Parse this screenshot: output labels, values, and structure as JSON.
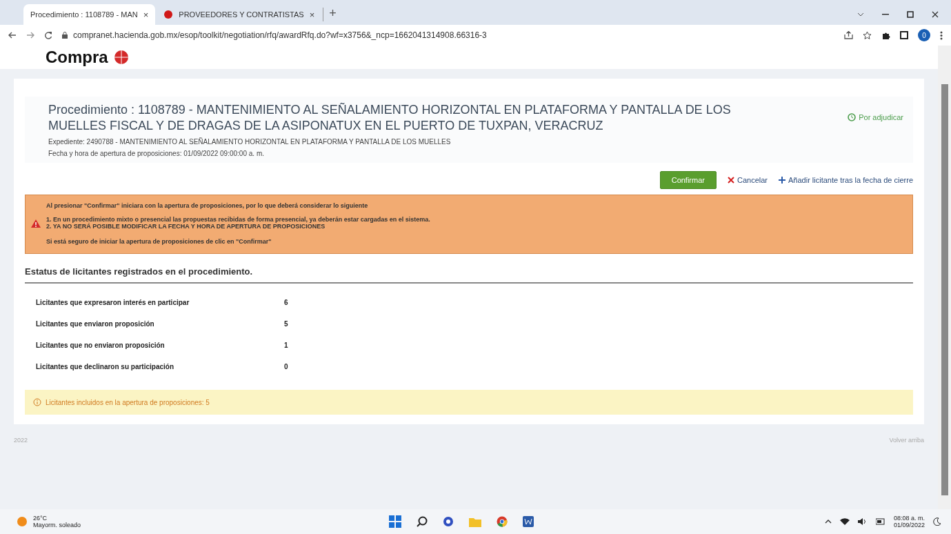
{
  "browser": {
    "tabs": [
      {
        "title": "Procedimiento : 1108789 - MAN",
        "close": "×",
        "selected": true,
        "kind": "page"
      },
      {
        "title": "PROVEEDORES Y CONTRATISTAS",
        "close": "×",
        "selected": false,
        "kind": "site"
      }
    ],
    "new_tab": "+",
    "url": "compranet.hacienda.gob.mx/esop/toolkit/negotiation/rfq/awardRfq.do?wf=x3756&_ncp=1662041314908.66316-3",
    "profile": "0"
  },
  "logo": {
    "text": "Compra"
  },
  "procedure": {
    "title": "Procedimiento : 1108789 - MANTENIMIENTO AL SEÑALAMIENTO HORIZONTAL EN PLATAFORMA Y PANTALLA DE LOS MUELLES FISCAL Y DE DRAGAS DE LA ASIPONATUX EN EL PUERTO DE TUXPAN, VERACRUZ",
    "file": "Expediente: 2490788 - MANTENIMIENTO AL SEÑALAMIENTO HORIZONTAL EN PLATAFORMA Y PANTALLA DE LOS MUELLES",
    "opening": "Fecha y hora de apertura de proposiciones: 01/09/2022 09:00:00 a. m.",
    "status": "Por adjudicar"
  },
  "actions": [
    {
      "kind": "primary",
      "label": "Confirmar"
    },
    {
      "kind": "cancel",
      "label": "Cancelar"
    },
    {
      "kind": "add",
      "label": "Añadir licitante tras la fecha de cierre"
    }
  ],
  "warning": {
    "intro": "Al presionar \"Confirmar\" iniciara con la apertura de proposiciones, por lo que deberá considerar lo siguiente",
    "points": [
      "1. En un procedimiento mixto o presencial las propuestas recibidas de forma presencial, ya deberán estar cargadas en el sistema.",
      "2. YA NO SERÁ POSIBLE MODIFICAR LA FECHA Y HORA DE APERTURA DE PROPOSICIONES"
    ],
    "outro": "Si está seguro de iniciar la apertura de proposiciones de clic en \"Confirmar\""
  },
  "stats": {
    "heading": "Estatus de licitantes registrados en el procedimiento.",
    "rows": [
      {
        "label": "Licitantes que expresaron interés en participar",
        "value": "6"
      },
      {
        "label": "Licitantes que enviaron proposición",
        "value": "5"
      },
      {
        "label": "Licitantes que no enviaron proposición",
        "value": "1"
      },
      {
        "label": "Licitantes que declinaron su participación",
        "value": "0"
      }
    ]
  },
  "info": "Licitantes incluidos en la apertura de proposiciones: 5",
  "footer": {
    "year": "2022",
    "back_to_top": "Volver arriba"
  },
  "taskbar": {
    "temperature": "26°C",
    "weather": "Mayorm. soleado",
    "time": "08:08 a. m.",
    "date": "01/09/2022"
  }
}
